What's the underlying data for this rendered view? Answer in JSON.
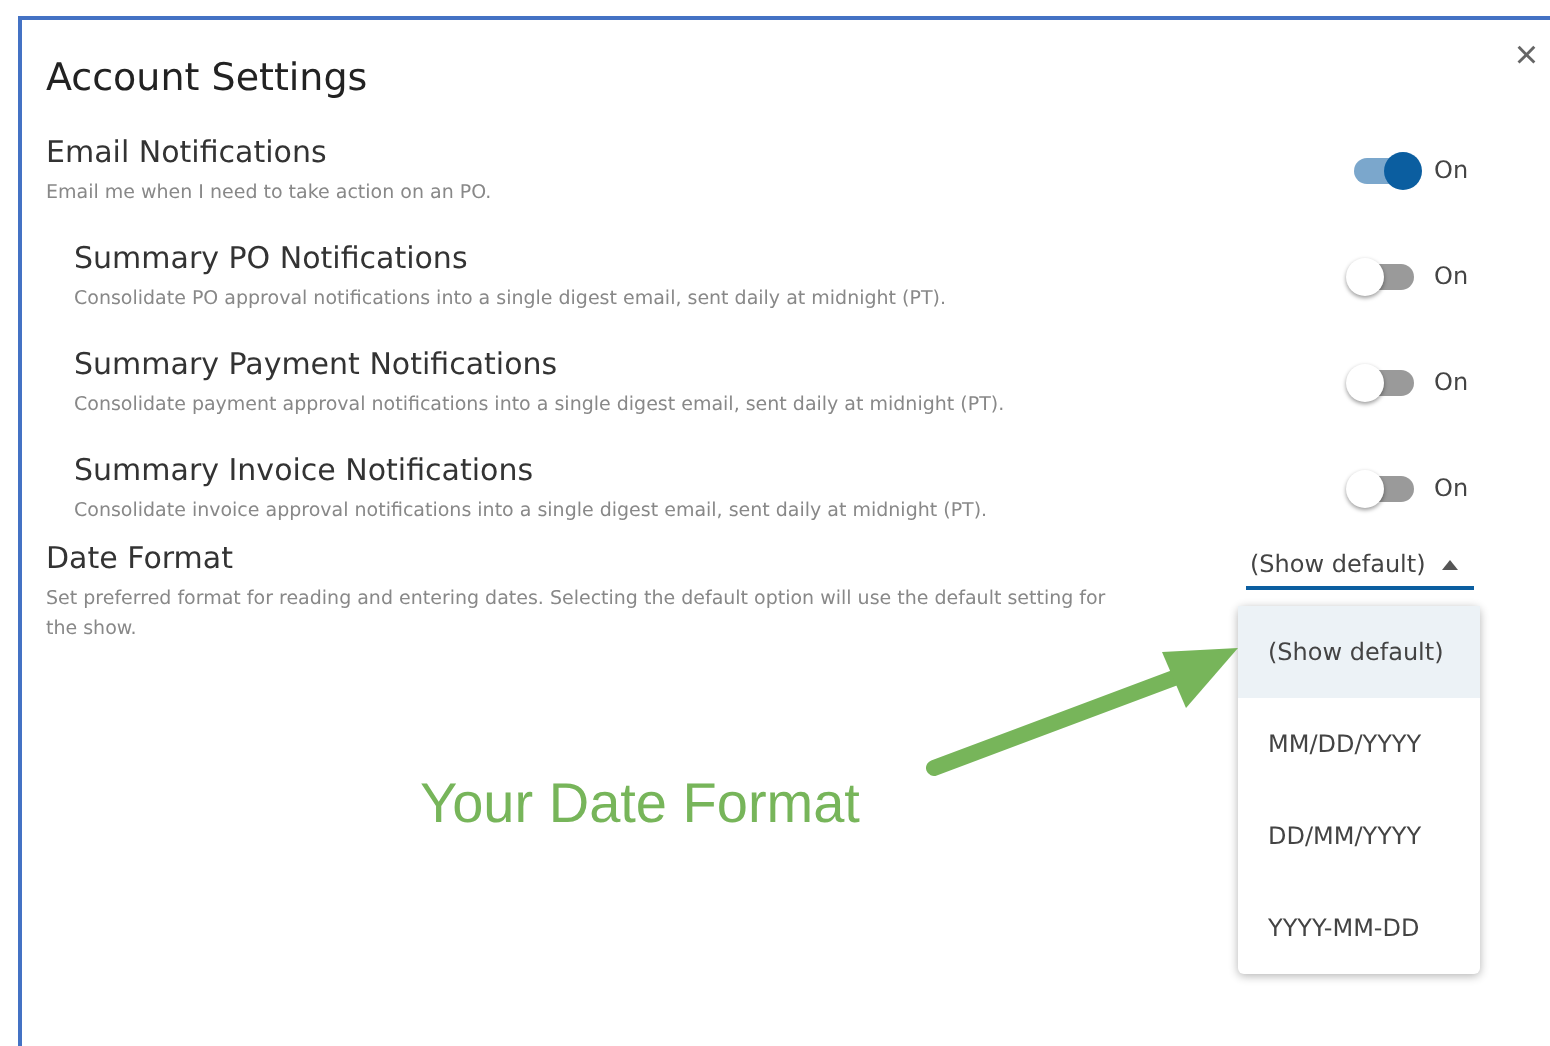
{
  "dialog": {
    "title": "Account Settings",
    "close": "×"
  },
  "settings": [
    {
      "kind": "toggle",
      "title": "Email Notifications",
      "description": "Email me when I need to take action on an PO.",
      "on": true,
      "state_label": "On",
      "nested": false
    },
    {
      "kind": "toggle",
      "title": "Summary PO Notifications",
      "description": "Consolidate PO approval notifications into a single digest email, sent daily at midnight (PT).",
      "on": false,
      "state_label": "On",
      "nested": true
    },
    {
      "kind": "toggle",
      "title": "Summary Payment Notifications",
      "description": "Consolidate payment approval notifications into a single digest email, sent daily at midnight (PT).",
      "on": false,
      "state_label": "On",
      "nested": true
    },
    {
      "kind": "toggle",
      "title": "Summary Invoice Notifications",
      "description": "Consolidate invoice approval notifications into a single digest email, sent daily at midnight (PT).",
      "on": false,
      "state_label": "On",
      "nested": true
    },
    {
      "kind": "dropdown",
      "title": "Date Format",
      "description": "Set preferred format for reading and entering dates. Selecting the default option will use the default setting for the show.",
      "value": "(Show default)",
      "expanded": true,
      "nested": false,
      "options": [
        {
          "label": "(Show default)",
          "selected": true
        },
        {
          "label": "MM/DD/YYYY",
          "selected": false
        },
        {
          "label": "DD/MM/YYYY",
          "selected": false
        },
        {
          "label": "YYYY-MM-DD",
          "selected": false
        }
      ]
    }
  ],
  "annotation": {
    "text": "Your Date Format"
  }
}
